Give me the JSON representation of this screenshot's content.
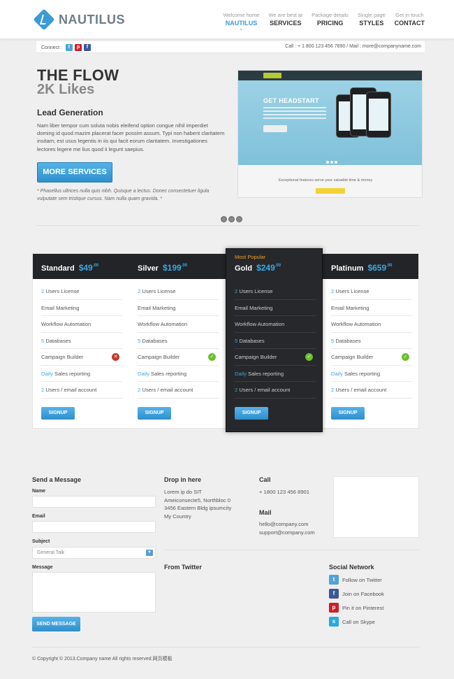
{
  "brand": {
    "name": "NAUTILUS"
  },
  "nav": [
    {
      "sub": "Welcome home",
      "label": "NAUTILUS"
    },
    {
      "sub": "We are best at",
      "label": "SERVICES"
    },
    {
      "sub": "Package details",
      "label": "PRICING"
    },
    {
      "sub": "Single page",
      "label": "STYLES"
    },
    {
      "sub": "Get in touch",
      "label": "CONTACT"
    }
  ],
  "topbar": {
    "connect_label": "Connect :",
    "contact_info": "Call : + 1 800 123 456 7890 / Mail : more@companyname.com"
  },
  "hero": {
    "title": "THE FLOW",
    "likes": "2K Likes",
    "subtitle": "Lead Generation",
    "text": "Nam liber tempor cum soluta nobis eleifend option congue nihil imperdiet doming id quod mazim placerat facer possim assum. Typi non habent claritatem insitam; est usus legentis in iis qui facit eorum claritatem. Investigationes lectores legere me lius quod ii legunt saepius.",
    "button": "MORE SERVICES",
    "note": "* Phasellus ultrices nulla quis nibh. Quisque a lectus. Donec consectetuer ligula vulputate sem tristique cursus. Nam nulla quam gravida. *",
    "image": {
      "headline_a": "GET HEADSTART",
      "headline_b": "",
      "tagline": "Exceptional features serve your valuable time & money"
    }
  },
  "pricing": {
    "plans": [
      {
        "name": "Standard",
        "price": "$49",
        "cents": ".00",
        "popular": "",
        "features": [
          {
            "num": "2",
            "text": " Users License",
            "icon": ""
          },
          {
            "num": "",
            "text": "Email Marketing",
            "icon": ""
          },
          {
            "num": "",
            "text": "Workflow Automation",
            "icon": ""
          },
          {
            "num": "5",
            "text": " Databases",
            "icon": ""
          },
          {
            "num": "",
            "text": "Campaign Builder",
            "icon": "cross"
          },
          {
            "num": "Daily",
            "text": " Sales reporting",
            "icon": ""
          },
          {
            "num": "2",
            "text": " Users / email account",
            "icon": ""
          }
        ],
        "button": "SIGNUP"
      },
      {
        "name": "Silver",
        "price": "$199",
        "cents": ".00",
        "popular": "",
        "features": [
          {
            "num": "2",
            "text": " Users License",
            "icon": ""
          },
          {
            "num": "",
            "text": "Email Marketing",
            "icon": ""
          },
          {
            "num": "",
            "text": "Workflow Automation",
            "icon": ""
          },
          {
            "num": "5",
            "text": " Databases",
            "icon": ""
          },
          {
            "num": "",
            "text": "Campaign Builder",
            "icon": "check"
          },
          {
            "num": "Daily",
            "text": " Sales reporting",
            "icon": ""
          },
          {
            "num": "2",
            "text": " Users / email account",
            "icon": ""
          }
        ],
        "button": "SIGNUP"
      },
      {
        "name": "Gold",
        "price": "$249",
        "cents": ".00",
        "popular": "Most Popular",
        "features": [
          {
            "num": "2",
            "text": " Users License",
            "icon": ""
          },
          {
            "num": "",
            "text": "Email Marketing",
            "icon": ""
          },
          {
            "num": "",
            "text": "Workflow Automation",
            "icon": ""
          },
          {
            "num": "5",
            "text": " Databases",
            "icon": ""
          },
          {
            "num": "",
            "text": "Campaign Builder",
            "icon": "check"
          },
          {
            "num": "Daily",
            "text": " Sales reporting",
            "icon": ""
          },
          {
            "num": "2",
            "text": " Users / email account",
            "icon": ""
          }
        ],
        "button": "SIGNUP"
      },
      {
        "name": "Platinum",
        "price": "$659",
        "cents": ".00",
        "popular": "",
        "features": [
          {
            "num": "2",
            "text": " Users License",
            "icon": ""
          },
          {
            "num": "",
            "text": "Email Marketing",
            "icon": ""
          },
          {
            "num": "",
            "text": "Workflow Automation",
            "icon": ""
          },
          {
            "num": "5",
            "text": " Databases",
            "icon": ""
          },
          {
            "num": "",
            "text": "Campaign Builder",
            "icon": "check"
          },
          {
            "num": "Daily",
            "text": " Sales reporting",
            "icon": ""
          },
          {
            "num": "2",
            "text": " Users / email account",
            "icon": ""
          }
        ],
        "button": "SIGNUP"
      }
    ]
  },
  "contact": {
    "form_title": "Send a Message",
    "name_label": "Name",
    "email_label": "Email",
    "subject_label": "Subject",
    "subject_value": "General Talk",
    "message_label": "Message",
    "send_button": "SEND MESSAGE",
    "address_title": "Drop in here",
    "address_lines": [
      "Lorem ip do SIT",
      "Ameiconsecte5, Northbloc 0",
      "3456 Eastern Bldg ipsumcity",
      "My Country"
    ],
    "call_title": "Call",
    "phone": "+ 1800 123 456 8901",
    "mail_title": "Mail",
    "emails": [
      "hello@company.com",
      "support@company.com"
    ],
    "twitter_title": "From Twitter",
    "social_title": "Social Network",
    "social": [
      {
        "icon": "twitter-icon",
        "label": "Follow on Twitter",
        "color": "#4fa3d8",
        "glyph": "t"
      },
      {
        "icon": "facebook-icon",
        "label": "Join on Facebook",
        "color": "#3b5998",
        "glyph": "f"
      },
      {
        "icon": "pinterest-icon",
        "label": "Pin it on Pinterest",
        "color": "#cb2027",
        "glyph": "p"
      },
      {
        "icon": "skype-icon",
        "label": "Call on Skype",
        "color": "#28a9e0",
        "glyph": "s"
      }
    ]
  },
  "footer": {
    "copyright": "© Copyright © 2013.Company name All rights reserved.网页模板"
  },
  "colors": {
    "accent": "#3b9bd6",
    "dark": "#222427",
    "popular": "#f1a02b"
  }
}
